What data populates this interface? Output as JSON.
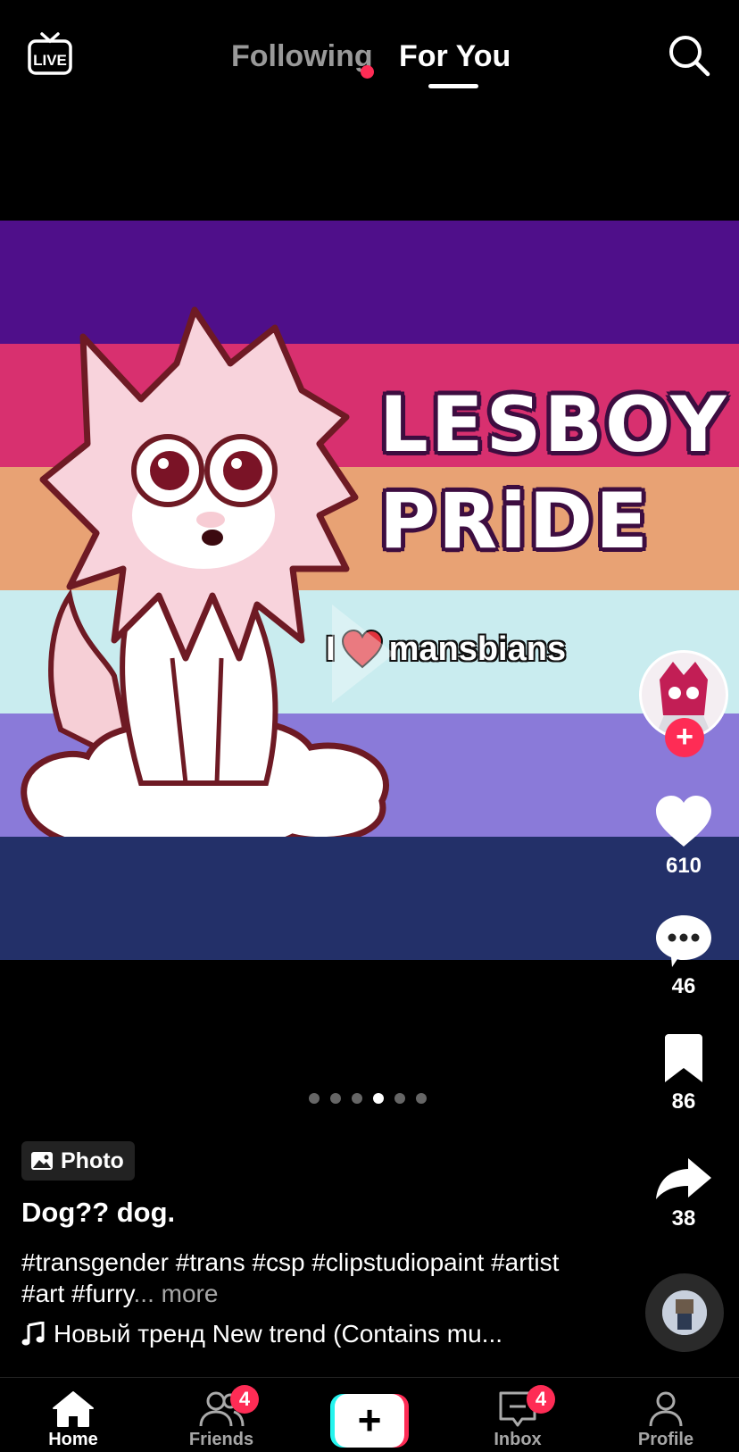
{
  "top_bar": {
    "live_label": "LIVE",
    "tabs": [
      {
        "label": "Following",
        "has_notification_dot": true
      },
      {
        "label": "For You",
        "active": true
      }
    ]
  },
  "media": {
    "flag_colors": [
      "#4f0f8a",
      "#d8306f",
      "#e8a274",
      "#c9ecef",
      "#8a7ad9",
      "#233069"
    ],
    "title_line_1": "LESBOY",
    "title_line_2": "PRiDE",
    "caption_prefix": "I",
    "caption_suffix": "mansbians",
    "page_count": 6,
    "active_page": 4
  },
  "actions": {
    "likes": "610",
    "comments": "46",
    "saves": "86",
    "shares": "38"
  },
  "post": {
    "type_badge": "Photo",
    "title": "Dog?? dog.",
    "hashtags": "#transgender #trans #csp #clipstudiopaint #artist #art #furry",
    "ellipsis": "...",
    "more_label": "more",
    "music": "Новый тренд New trend (Contains mu..."
  },
  "bottom_nav": {
    "home": "Home",
    "friends": "Friends",
    "friends_badge": "4",
    "inbox": "Inbox",
    "inbox_badge": "4",
    "profile": "Profile",
    "create_symbol": "+"
  },
  "colors": {
    "accent": "#fe2c55",
    "create_left": "#25f4ee"
  }
}
